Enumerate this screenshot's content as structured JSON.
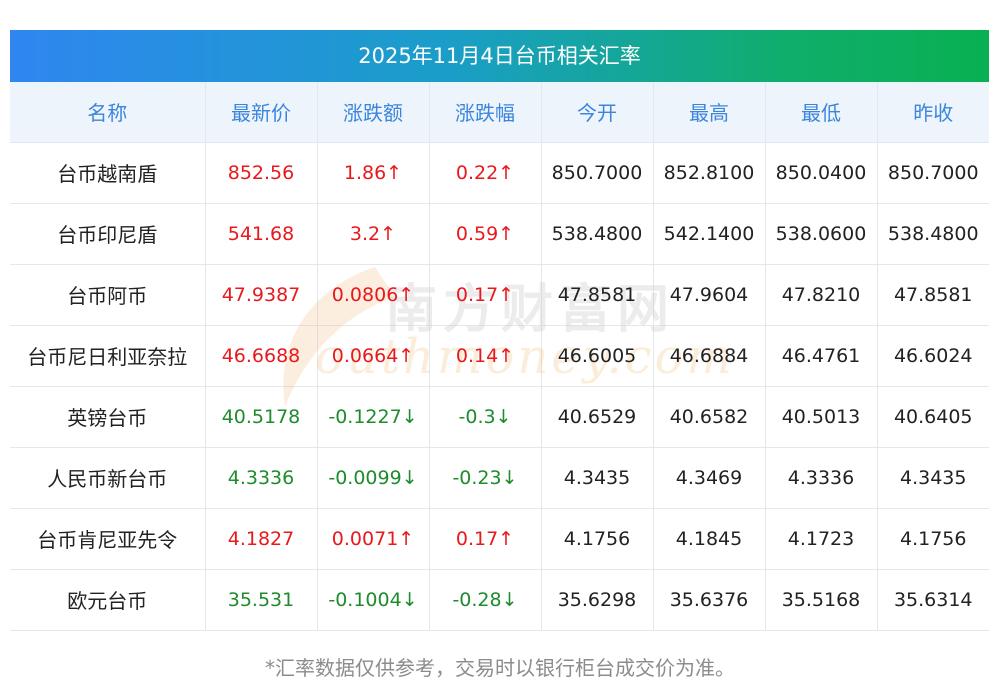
{
  "title": "2025年11月4日台币相关汇率",
  "headers": [
    "名称",
    "最新价",
    "涨跌额",
    "涨跌幅",
    "今开",
    "最高",
    "最低",
    "昨收"
  ],
  "rows": [
    {
      "name": "台币越南盾",
      "latest": "852.56",
      "change": "1.86↑",
      "pct": "0.22↑",
      "open": "850.7000",
      "high": "852.8100",
      "low": "850.0400",
      "prev": "850.7000",
      "trend": "up"
    },
    {
      "name": "台币印尼盾",
      "latest": "541.68",
      "change": "3.2↑",
      "pct": "0.59↑",
      "open": "538.4800",
      "high": "542.1400",
      "low": "538.0600",
      "prev": "538.4800",
      "trend": "up"
    },
    {
      "name": "台币阿币",
      "latest": "47.9387",
      "change": "0.0806↑",
      "pct": "0.17↑",
      "open": "47.8581",
      "high": "47.9604",
      "low": "47.8210",
      "prev": "47.8581",
      "trend": "up"
    },
    {
      "name": "台币尼日利亚奈拉",
      "latest": "46.6688",
      "change": "0.0664↑",
      "pct": "0.14↑",
      "open": "46.6005",
      "high": "46.6884",
      "low": "46.4761",
      "prev": "46.6024",
      "trend": "up"
    },
    {
      "name": "英镑台币",
      "latest": "40.5178",
      "change": "-0.1227↓",
      "pct": "-0.3↓",
      "open": "40.6529",
      "high": "40.6582",
      "low": "40.5013",
      "prev": "40.6405",
      "trend": "down"
    },
    {
      "name": "人民币新台币",
      "latest": "4.3336",
      "change": "-0.0099↓",
      "pct": "-0.23↓",
      "open": "4.3435",
      "high": "4.3469",
      "low": "4.3336",
      "prev": "4.3435",
      "trend": "down"
    },
    {
      "name": "台币肯尼亚先令",
      "latest": "4.1827",
      "change": "0.0071↑",
      "pct": "0.17↑",
      "open": "4.1756",
      "high": "4.1845",
      "low": "4.1723",
      "prev": "4.1756",
      "trend": "up"
    },
    {
      "name": "欧元台币",
      "latest": "35.531",
      "change": "-0.1004↓",
      "pct": "-0.28↓",
      "open": "35.6298",
      "high": "35.6376",
      "low": "35.5168",
      "prev": "35.6314",
      "trend": "down"
    }
  ],
  "watermark": {
    "cn": "南方财富网",
    "en": "outhmoney.com"
  },
  "footnote": "*汇率数据仅供参考，交易时以银行柜台成交价为准。",
  "colors": {
    "up": "#e8191d",
    "down": "#1e8c2c",
    "header_text": "#3b86dd",
    "title_gradient_start": "#2f86f0",
    "title_gradient_end": "#09b052"
  }
}
